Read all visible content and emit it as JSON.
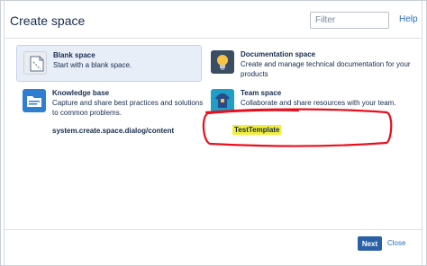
{
  "dialog": {
    "title": "Create space",
    "filter_placeholder": "Filter",
    "help_label": "Help"
  },
  "spaces": {
    "blank": {
      "name": "Blank space",
      "description": "Start with a blank space.",
      "icon": "blank-page-icon"
    },
    "documentation": {
      "name": "Documentation space",
      "description": "Create and manage technical documentation for your products",
      "icon": "lightbulb-icon"
    },
    "knowledge_base": {
      "name": "Knowledge base",
      "description": "Capture and share best practices and solutions to common problems.",
      "icon": "folder-icon"
    },
    "team": {
      "name": "Team space",
      "description": "Collaborate and share resources with your team.",
      "icon": "team-shirt-icon"
    }
  },
  "plugin_item": {
    "label": "system.create.space.dialog/content"
  },
  "template_item": {
    "label": "TestTemplate",
    "highlight_color": "#f2ef3c",
    "annotation_color": "#e8101e"
  },
  "footer": {
    "next_label": "Next",
    "close_label": "Close"
  },
  "colors": {
    "primary": "#2a60a8",
    "link": "#2a6ebb",
    "selected_bg": "#e8eef8"
  }
}
